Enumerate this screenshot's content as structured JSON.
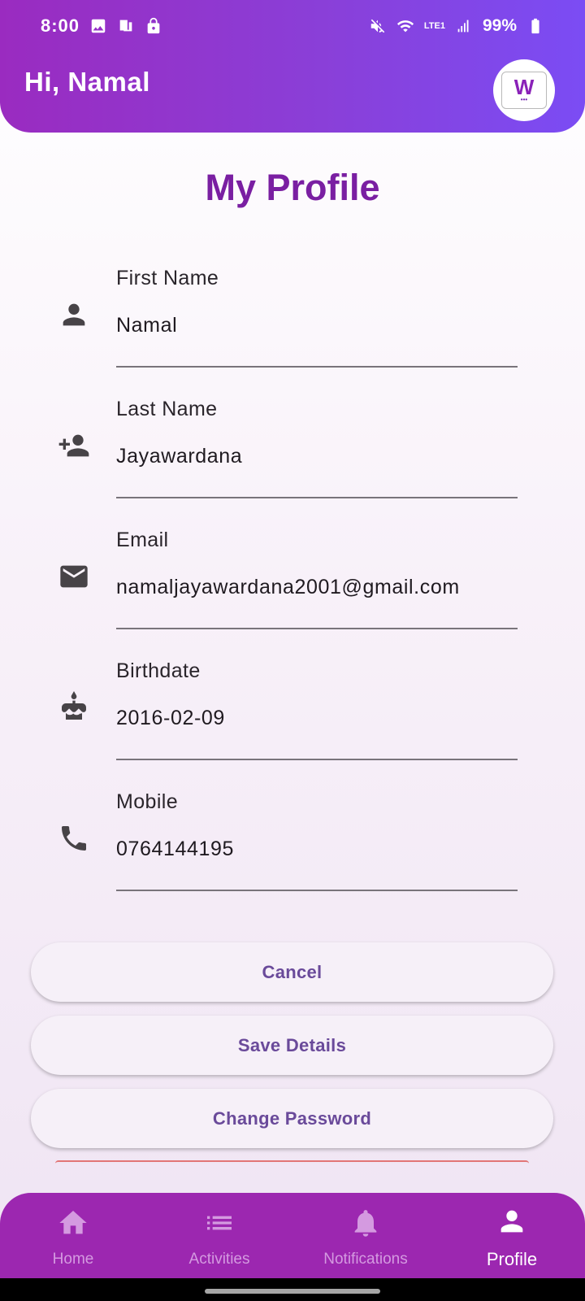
{
  "status_bar": {
    "time": "8:00",
    "battery": "99%",
    "network_label": "LTE1"
  },
  "header": {
    "greeting": "Hi, Namal"
  },
  "page": {
    "title": "My Profile"
  },
  "fields": [
    {
      "label": "First Name",
      "value": "Namal",
      "icon": "person-icon"
    },
    {
      "label": "Last Name",
      "value": "Jayawardana",
      "icon": "person-add-icon"
    },
    {
      "label": "Email",
      "value": "namaljayawardana2001@gmail.com",
      "icon": "email-icon"
    },
    {
      "label": "Birthdate",
      "value": "2016-02-09",
      "icon": "cake-icon"
    },
    {
      "label": "Mobile",
      "value": "0764144195",
      "icon": "phone-icon"
    }
  ],
  "buttons": {
    "cancel": "Cancel",
    "save": "Save Details",
    "change_password": "Change Password"
  },
  "nav": [
    {
      "label": "Home",
      "icon": "home-icon",
      "active": false
    },
    {
      "label": "Activities",
      "icon": "list-icon",
      "active": false
    },
    {
      "label": "Notifications",
      "icon": "bell-icon",
      "active": false
    },
    {
      "label": "Profile",
      "icon": "person-icon",
      "active": true
    }
  ],
  "colors": {
    "header_gradient_start": "#9a2bc0",
    "header_gradient_end": "#7b4cf4",
    "title": "#7a1fa2",
    "nav_background": "#9c27b0",
    "button_text": "#6a4a9a"
  }
}
